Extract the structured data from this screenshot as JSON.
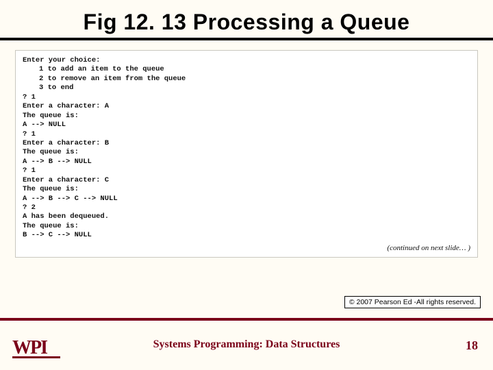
{
  "title": "Fig 12. 13 Processing a Queue",
  "console": {
    "l01": "Enter your choice:",
    "l02": "1 to add an item to the queue",
    "l03": "2 to remove an item from the queue",
    "l04": "3 to end",
    "l05": "? 1",
    "l06": "Enter a character: A",
    "l07": "The queue is:",
    "l08": "A --> NULL",
    "l09": "",
    "l10": "? 1",
    "l11": "Enter a character: B",
    "l12": "The queue is:",
    "l13": "A --> B --> NULL",
    "l14": "",
    "l15": "? 1",
    "l16": "Enter a character: C",
    "l17": "The queue is:",
    "l18": "A --> B --> C --> NULL",
    "l19": "",
    "l20": "? 2",
    "l21": "A has been dequeued.",
    "l22": "The queue is:",
    "l23": "B --> C --> NULL",
    "continued": "(continued on next slide… )"
  },
  "copyright": "© 2007 Pearson Ed -All rights reserved.",
  "footer": {
    "course_prefix": "Systems Programming:",
    "course_topic": "  Data Structures",
    "page": "18",
    "logo_text": "WPI"
  }
}
